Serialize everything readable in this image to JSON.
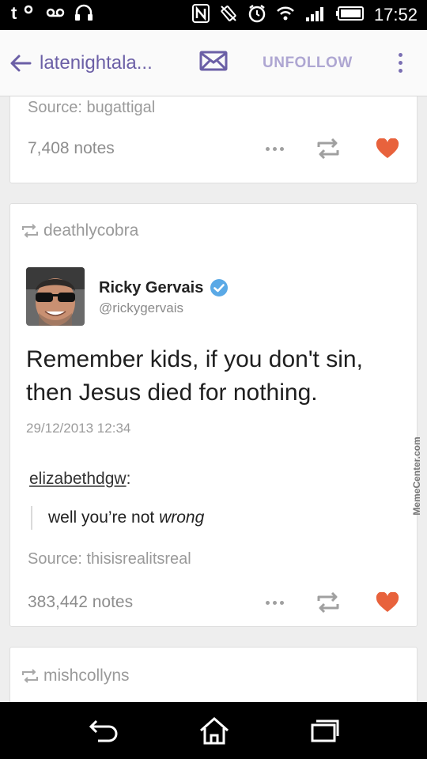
{
  "status_bar": {
    "time": "17:52",
    "left_icons": [
      "tumblr-notification-icon",
      "voicemail-icon",
      "headphones-icon"
    ],
    "right_icons": [
      "nfc-icon",
      "vibrate-icon",
      "alarm-icon",
      "wifi-icon",
      "signal-icon",
      "battery-icon"
    ]
  },
  "app_bar": {
    "blog_name": "latenightala...",
    "unfollow_label": "UNFOLLOW"
  },
  "posts": [
    {
      "source": "Source: bugattigal",
      "notes": "7,408 notes"
    },
    {
      "reblogger": "deathlycobra",
      "tweet": {
        "name": "Ricky Gervais",
        "handle": "@rickygervais",
        "text": "Remember kids, if you don't sin, then Jesus died for nothing.",
        "date": "29/12/2013 12:34"
      },
      "commenter": "elizabethdgw",
      "comment_prefix": "well you’re not ",
      "comment_emphasis": "wrong",
      "source": "Source: thisisrealitsreal",
      "notes": "383,442 notes"
    },
    {
      "reblogger": "mishcollyns"
    }
  ],
  "watermark": "MemeCenter.com",
  "colors": {
    "accent": "#6b5fa6",
    "unfollow": "#aea6d2",
    "like": "#e8623c",
    "verified": "#5aa9e6"
  }
}
